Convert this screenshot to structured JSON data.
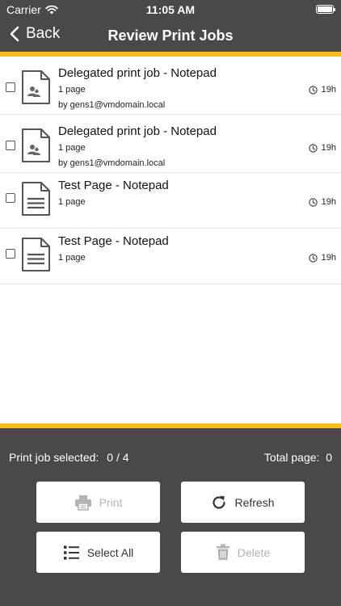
{
  "status_bar": {
    "carrier": "Carrier",
    "time": "11:05 AM"
  },
  "nav": {
    "back_label": "Back",
    "title": "Review Print Jobs"
  },
  "colors": {
    "bar_background": "#4a4948",
    "accent_stripe": "#f5be1a",
    "disabled_text": "#b3b3b3"
  },
  "jobs": [
    {
      "title": "Delegated print job - Notepad",
      "pages": "1  page",
      "owner": "by  gens1@vmdomain.local",
      "age": "19h",
      "icon": "delegated-document-icon",
      "selected": false
    },
    {
      "title": "Delegated print job - Notepad",
      "pages": "1  page",
      "owner": "by  gens1@vmdomain.local",
      "age": "19h",
      "icon": "delegated-document-icon",
      "selected": false
    },
    {
      "title": "Test Page - Notepad",
      "pages": "1  page",
      "owner": "",
      "age": "19h",
      "icon": "text-document-icon",
      "selected": false
    },
    {
      "title": "Test Page - Notepad",
      "pages": "1  page",
      "owner": "",
      "age": "19h",
      "icon": "text-document-icon",
      "selected": false
    }
  ],
  "footer": {
    "selected_label": "Print job selected:",
    "selected_count": "0 / 4",
    "total_label": "Total page:",
    "total_value": "0",
    "buttons": {
      "print": {
        "label": "Print",
        "icon": "printer-icon",
        "enabled": false
      },
      "refresh": {
        "label": "Refresh",
        "icon": "refresh-icon",
        "enabled": true
      },
      "select_all": {
        "label": "Select All",
        "icon": "list-icon",
        "enabled": true
      },
      "delete": {
        "label": "Delete",
        "icon": "trash-icon",
        "enabled": false
      }
    }
  }
}
